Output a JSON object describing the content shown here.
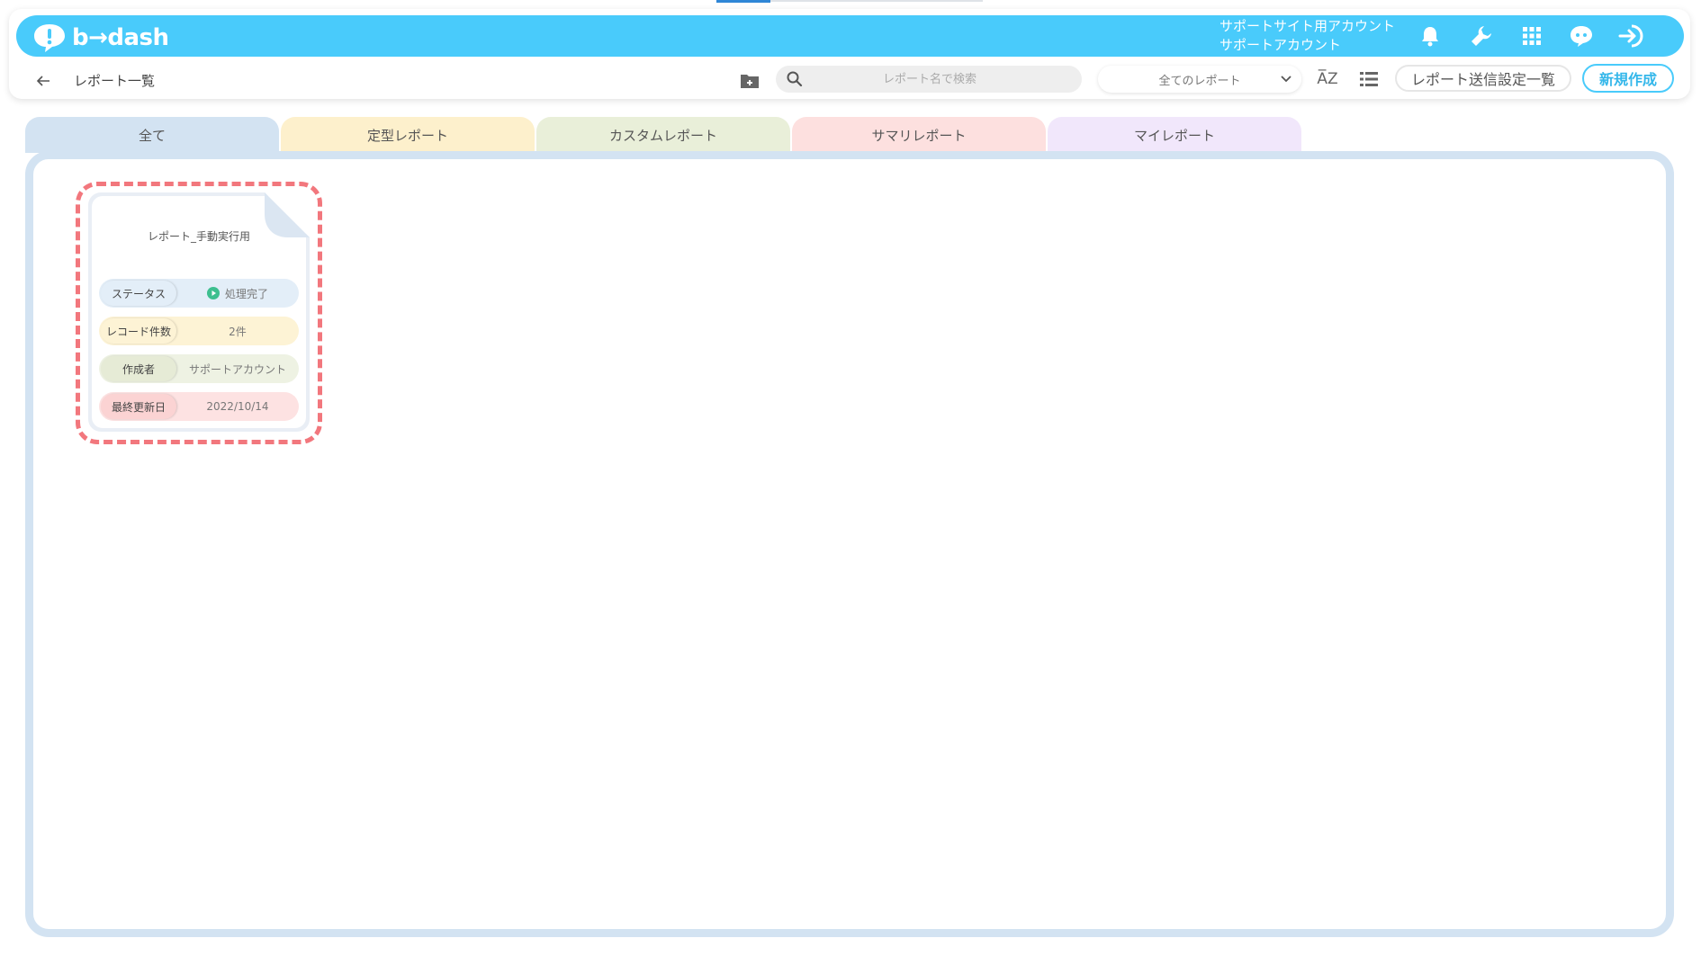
{
  "header": {
    "logo_text": "b→dash",
    "account_line1": "サポートサイト用アカウント",
    "account_line2": "サポートアカウント",
    "bg_color": "#49cbfb",
    "icons": [
      "bell-icon",
      "wrench-icon",
      "apps-grid-icon",
      "support-chat-icon",
      "logout-icon"
    ]
  },
  "toolbar": {
    "breadcrumb": "レポート一覧",
    "search_placeholder": "レポート名で検索",
    "filter_selected": "全てのレポート",
    "sort_label": "A̅Z",
    "send_settings_label": "レポート送信設定一覧",
    "new_label": "新規作成",
    "accent_color": "#49cbfb"
  },
  "tabs": [
    {
      "label": "全て",
      "color": "#d3e3f2"
    },
    {
      "label": "定型レポート",
      "color": "#fdf0cc"
    },
    {
      "label": "カスタムレポート",
      "color": "#e9efd9"
    },
    {
      "label": "サマリレポート",
      "color": "#fde0df"
    },
    {
      "label": "マイレポート",
      "color": "#f1e7fb"
    }
  ],
  "report_card": {
    "title": "レポート_手動実行用",
    "rows": [
      {
        "label": "ステータス",
        "value": "処理完了",
        "color": "#e3eef8"
      },
      {
        "label": "レコード件数",
        "value": "2件",
        "color": "#fdf3d5"
      },
      {
        "label": "作成者",
        "value": "サポートアカウント",
        "color": "#eef2e3"
      },
      {
        "label": "最終更新日",
        "value": "2022/10/14",
        "color": "#fde2e2"
      }
    ],
    "status_color": "#3dbf8f",
    "highlight_color": "#f2777d"
  }
}
